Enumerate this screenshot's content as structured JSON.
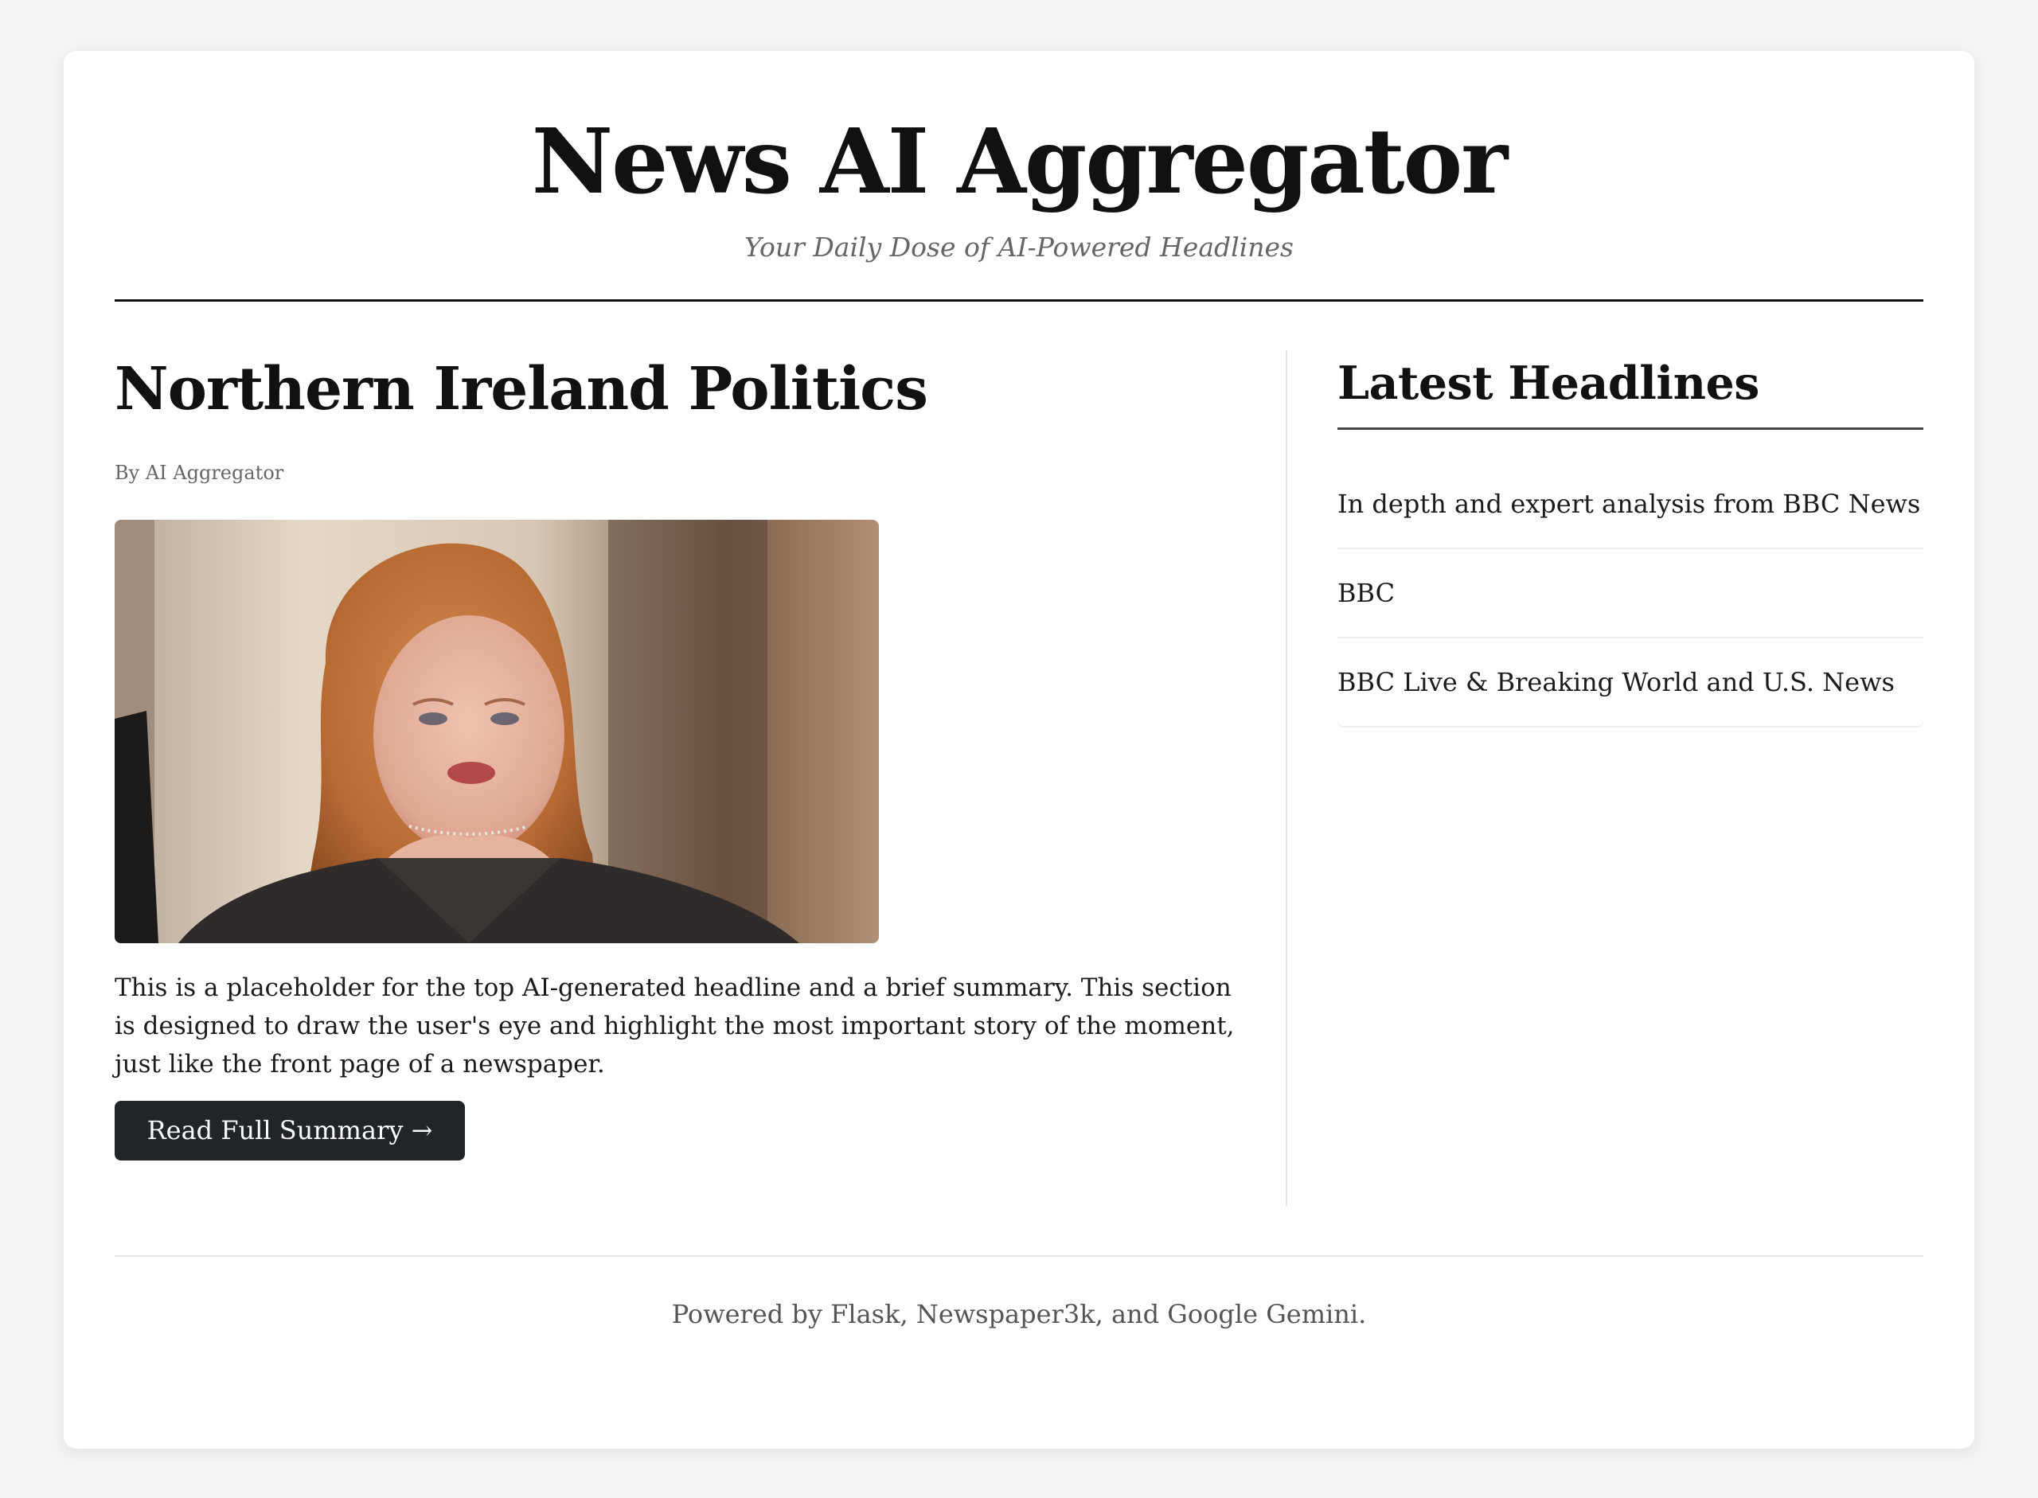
{
  "header": {
    "title": "News AI Aggregator",
    "tagline": "Your Daily Dose of AI-Powered Headlines"
  },
  "top_story": {
    "title": "Northern Ireland Politics",
    "byline": "By AI Aggregator",
    "image_alt": "Woman with long auburn hair speaking",
    "summary": "This is a placeholder for the top AI-generated headline and a brief summary. This section is designed to draw the user's eye and highlight the most important story of the moment, just like the front page of a newspaper.",
    "button_label": "Read Full Summary →"
  },
  "sidebar": {
    "title": "Latest Headlines",
    "items": [
      {
        "label": "In depth and expert analysis from BBC News"
      },
      {
        "label": "BBC"
      },
      {
        "label": "BBC Live & Breaking World and U.S. News"
      }
    ]
  },
  "footer": {
    "text": "Powered by Flask, Newspaper3k, and Google Gemini."
  },
  "colors": {
    "page_background": "#f4f4f4",
    "card_background": "#ffffff",
    "button_background": "#212428",
    "text_primary": "#111111",
    "text_muted": "#666666"
  }
}
